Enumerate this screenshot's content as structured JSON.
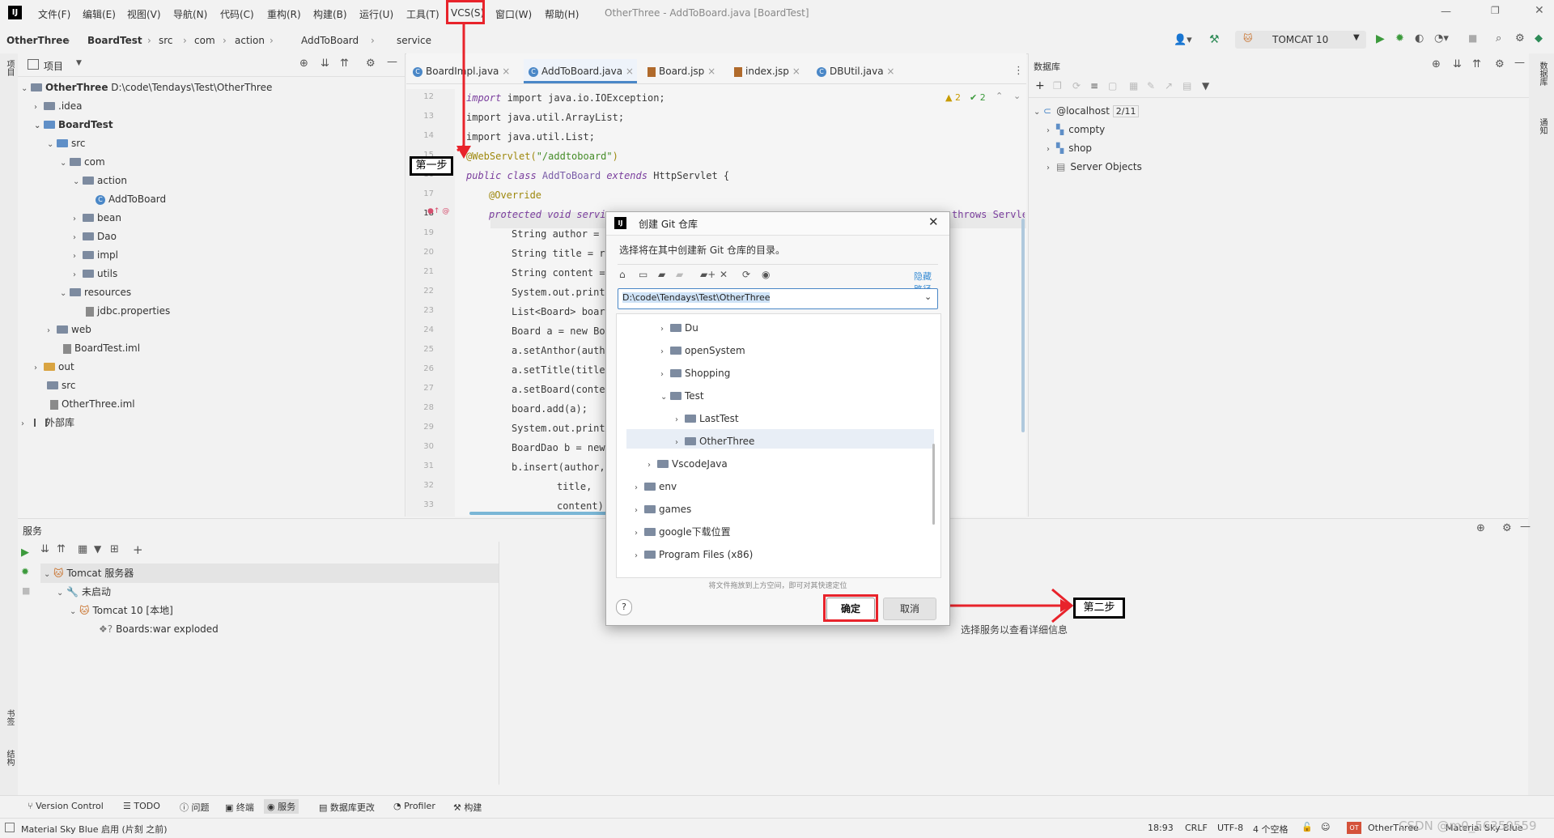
{
  "menubar": {
    "items": [
      "文件(F)",
      "编辑(E)",
      "视图(V)",
      "导航(N)",
      "代码(C)",
      "重构(R)",
      "构建(B)",
      "运行(U)",
      "工具(T)",
      "VCS(S)",
      "窗口(W)",
      "帮助(H)"
    ],
    "window_title": "OtherThree - AddToBoard.java [BoardTest]"
  },
  "breadcrumb": [
    "OtherThree",
    "BoardTest",
    "src",
    "com",
    "action",
    "AddToBoard",
    "service"
  ],
  "run_config": "TOMCAT 10",
  "project": {
    "header": "项目",
    "root_name": "OtherThree",
    "root_path": "D:\\code\\Tendays\\Test\\OtherThree",
    "tree": [
      ".idea",
      "BoardTest",
      "src",
      "com",
      "action",
      "AddToBoard",
      "bean",
      "Dao",
      "impl",
      "utils",
      "resources",
      "jdbc.properties",
      "web",
      "BoardTest.iml",
      "out",
      "src",
      "OtherThree.iml",
      "外部库"
    ]
  },
  "editor": {
    "tabs": [
      "BoardImpl.java",
      "AddToBoard.java",
      "Board.jsp",
      "index.jsp",
      "DBUtil.java"
    ],
    "inspections": {
      "warnings": "2",
      "ok": "2"
    },
    "line_numbers": [
      "12",
      "13",
      "14",
      "15",
      "16",
      "17",
      "18",
      "19",
      "20",
      "21",
      "22",
      "23",
      "24",
      "25",
      "26",
      "27",
      "28",
      "29",
      "30",
      "31",
      "32",
      "33"
    ],
    "code": {
      "l12": "import java.io.IOException;",
      "l13": "import java.util.ArrayList;",
      "l14": "import java.util.List;",
      "l15a": "@WebServlet(",
      "l15b": "\"/addtoboard\"",
      "l15c": ")",
      "l16a": "public class ",
      "l16b": "AddToBoard ",
      "l16c": "extends ",
      "l16d": "HttpServlet {",
      "l17": "@Override",
      "l18": "protected void servi",
      "l18tail": "throws Servle",
      "l19": "String author = r",
      "l20": "String title = re",
      "l21": "String content = ",
      "l22": "System.out.printl",
      "l23": "List<Board> board",
      "l24": "Board a = new Boa",
      "l25": "a.setAnthor(autho",
      "l26": "a.setTitle(title",
      "l27": "a.setBoard(conten",
      "l28": "board.add(a);",
      "l29": "System.out.printl",
      "l30": "BoardDao b = new ",
      "l31": "b.insert(author,",
      "l32": "title,",
      "l33": "content)"
    }
  },
  "database": {
    "header": "数据库",
    "host": "@localhost",
    "host_count": "2/11",
    "items": [
      "compty",
      "shop",
      "Server Objects"
    ]
  },
  "services": {
    "header": "服务",
    "tree": [
      "Tomcat 服务器",
      "未启动",
      "Tomcat 10 [本地]",
      "Boards:war exploded"
    ],
    "hint": "选择服务以查看详细信息"
  },
  "dialog": {
    "title": "创建 Git 仓库",
    "subtitle": "选择将在其中创建新 Git 仓库的目录。",
    "hide_path": "隐藏路径",
    "path": "D:\\code\\Tendays\\Test\\OtherThree",
    "folders": [
      "Du",
      "openSystem",
      "Shopping",
      "Test",
      "LastTest",
      "OtherThree",
      "VscodeJava",
      "env",
      "games",
      "google下载位置",
      "Program Files (x86)"
    ],
    "drag_hint": "将文件拖放到上方空间，即可对其快速定位",
    "help": "?",
    "ok": "确定",
    "cancel": "取消"
  },
  "annotations": {
    "step1": "第一步",
    "step2": "第二步",
    "accent": "#e8232b"
  },
  "toolstrip": [
    "Version Control",
    "TODO",
    "问题",
    "终端",
    "服务",
    "数据库更改",
    "Profiler",
    "构建"
  ],
  "statusbar": {
    "left": "Material Sky Blue 启用 (片刻 之前)",
    "position": "18:93",
    "line_sep": "CRLF",
    "encoding": "UTF-8",
    "indent": "4 个空格",
    "theme": "Material Sky Blue",
    "watermark": "CSDN @m0_56350559",
    "project": "OtherThree"
  },
  "side_labels": {
    "left_top": "项目",
    "left_bottom_1": "书签",
    "left_bottom_2": "结构",
    "right_1": "数据库",
    "right_2": "通知"
  }
}
